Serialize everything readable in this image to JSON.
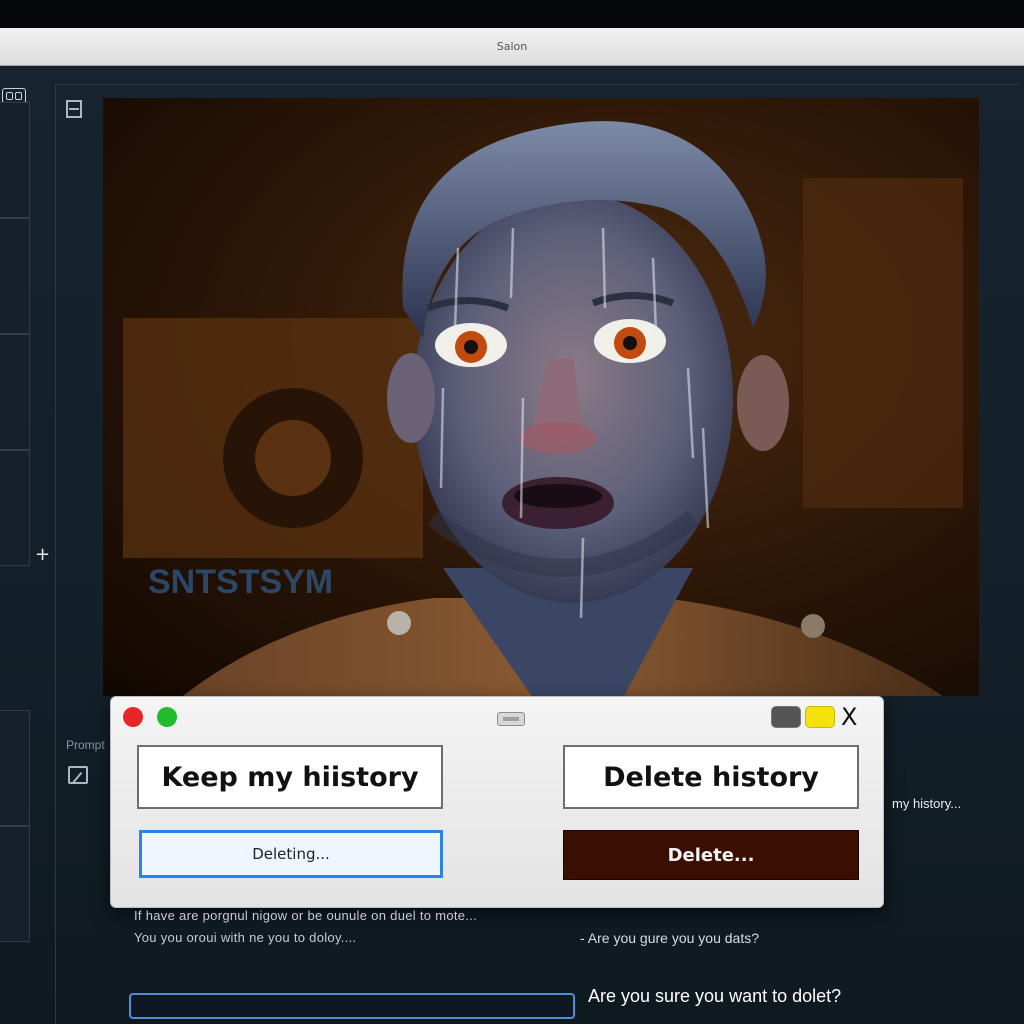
{
  "window": {
    "title": "Salon"
  },
  "sidebar": {
    "cells": 5
  },
  "artwork": {
    "alt_icon": "portrait-image"
  },
  "prompt_panel": {
    "label": "Prompt"
  },
  "dialog": {
    "keep_button": "Keep my hiistory",
    "delete_history_button": "Delete history",
    "deleting_button": "Deleting...",
    "delete_button": "Delete...",
    "close_glyph": "X"
  },
  "footer": {
    "side_text": "my history...",
    "info_line_1": "If have are porgnul nigow or be ounule on duel to mote...",
    "info_line_2": "You you oroui with ne you to doloy....",
    "question_short": "- Are you gure you you dats?",
    "question_long": "Are you sure you want to dolet?",
    "progress_fraction": 0
  },
  "colors": {
    "accent_blue": "#2a84e6",
    "delete_dark": "#3a0f02",
    "traffic_red": "#e8242a",
    "traffic_green": "#22bb2e",
    "traffic_yellow": "#f5e20c"
  }
}
